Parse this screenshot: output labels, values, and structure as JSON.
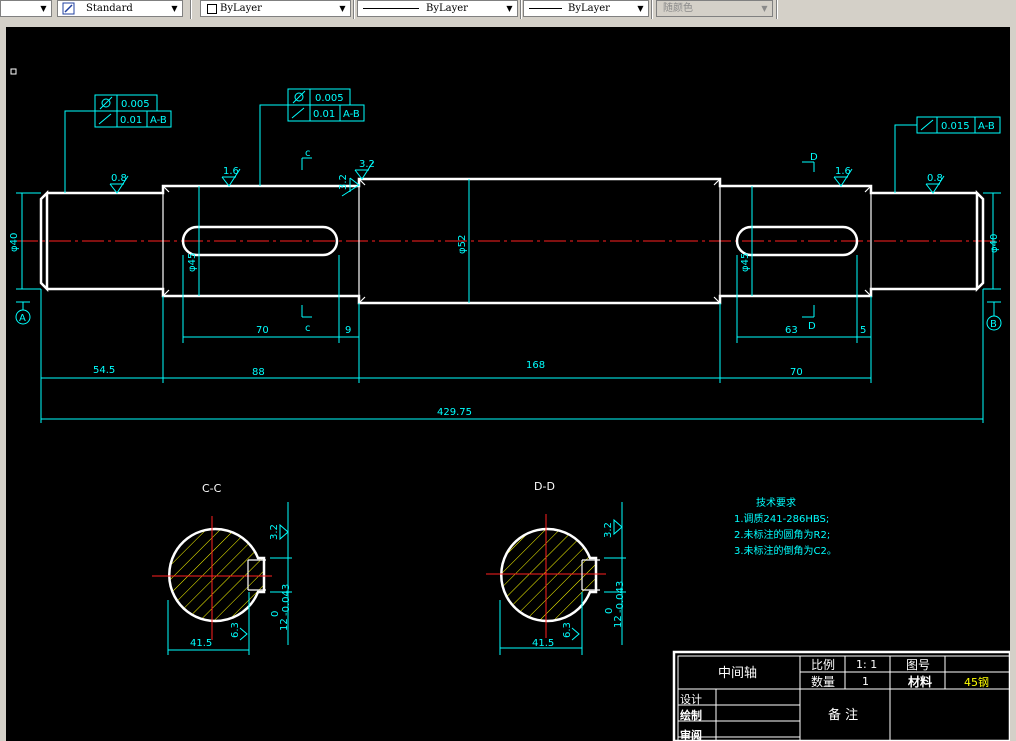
{
  "toolbar": {
    "text_style": "Standard",
    "layer": "ByLayer",
    "linetype": "ByLayer",
    "lineweight": "ByLayer",
    "color": "随颜色"
  },
  "drawing": {
    "tolerances": {
      "left_round": "0.005",
      "left_runout": "0.01",
      "left_datum": "A-B",
      "mid_round": "0.005",
      "mid_runout": "0.01",
      "mid_datum": "A-B",
      "right_runout": "0.015",
      "right_datum": "A-B"
    },
    "roughness": {
      "r1": "0.8",
      "r2": "1.6",
      "r3": "3.2",
      "r4": "3.2",
      "r5": "1.6",
      "r6": "0.8"
    },
    "section_marks": {
      "c_top": "c",
      "c_bottom": "c",
      "d_top": "D",
      "d_bottom": "D"
    },
    "datums": {
      "a": "A",
      "b": "B"
    },
    "diameters": {
      "d40_left": "φ40",
      "d_key_left": "φ45",
      "d52": "φ52",
      "d_key_right": "φ45",
      "d40_right": "φ40"
    },
    "dims": {
      "d70_key": "70",
      "d9": "9",
      "d63": "63",
      "d5": "5",
      "d54_5": "54.5",
      "d88": "88",
      "d168": "168",
      "d70_right": "70",
      "d_total": "429.75"
    },
    "sections": {
      "cc_title": "C-C",
      "cc_width": "41.5",
      "cc_rough": "3.2",
      "cc_rough2": "6.3",
      "cc_key": "12",
      "cc_key_tol_top": "0",
      "cc_key_tol_bot": "-0.043",
      "dd_title": "D-D",
      "dd_width": "41.5",
      "dd_rough": "3.2",
      "dd_rough2": "6.3",
      "dd_key": "12",
      "dd_key_tol_top": "0",
      "dd_key_tol_bot": "-0.043"
    },
    "tech_requirements": {
      "title": "技术要求",
      "items": [
        "1.调质241-286HBS;",
        "2.未标注的圆角为R2;",
        "3.未标注的倒角为C2。"
      ]
    },
    "title_block": {
      "part_name": "中间轴",
      "scale_label": "比例",
      "scale_value": "1: 1",
      "drawing_no_label": "图号",
      "qty_label": "数量",
      "qty_value": "1",
      "material_label": "材料",
      "material_value": "45钢",
      "design_label": "设计",
      "draw_label": "绘制",
      "review_label": "审阅",
      "remark_label": "备 注"
    }
  }
}
